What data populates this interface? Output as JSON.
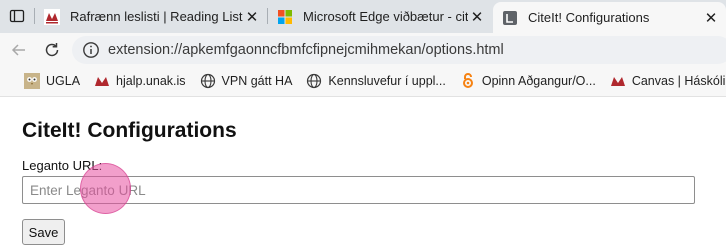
{
  "tabs": [
    {
      "title": "Rafrænn leslisti | Reading List",
      "icon": "unak-logo-icon",
      "close": "✕"
    },
    {
      "title": "Microsoft Edge viðbætur - cite it",
      "icon": "microsoft-logo-icon",
      "close": "✕"
    },
    {
      "title": "CiteIt! Configurations",
      "icon": "extension-page-icon",
      "close": "✕",
      "active": true
    }
  ],
  "address_bar": {
    "url": "extension://apkemfgaonncfbmfcfipnejcmihmekan/options.html"
  },
  "bookmarks": [
    {
      "label": "UGLA",
      "icon": "ugla-owl-icon"
    },
    {
      "label": "hjalp.unak.is",
      "icon": "unak-logo-icon"
    },
    {
      "label": "VPN gátt HA",
      "icon": "globe-icon"
    },
    {
      "label": "Kennsluvefur í uppl...",
      "icon": "globe-icon"
    },
    {
      "label": "Opinn Aðgangur/O...",
      "icon": "open-access-icon"
    },
    {
      "label": "Canvas | Háskólinn...",
      "icon": "unak-logo-icon"
    }
  ],
  "page": {
    "title": "CiteIt! Configurations",
    "field_label": "Leganto URL:",
    "input_placeholder": "Enter Leganto URL",
    "input_value": "",
    "save_label": "Save"
  },
  "colors": {
    "tab_strip_bg": "#dfe3e7",
    "toolbar_bg": "#f7f7f7",
    "unak_red": "#b0282e",
    "click_indicator": "#e850a0"
  }
}
